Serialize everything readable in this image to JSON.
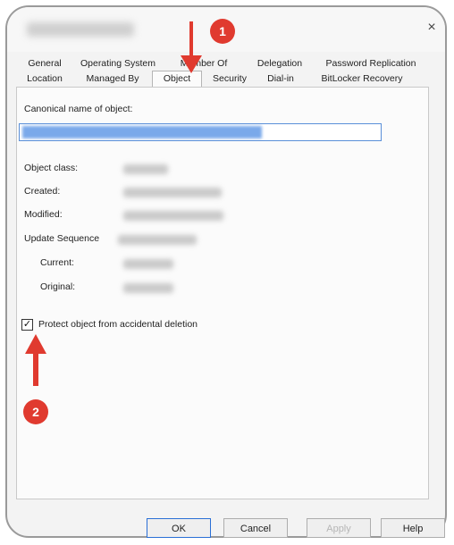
{
  "window": {
    "close_glyph": "×"
  },
  "tabs_row1": [
    "General",
    "Operating System",
    "Member Of",
    "Delegation",
    "Password Replication"
  ],
  "tabs_row2": [
    "Location",
    "Managed By",
    "Object",
    "Security",
    "Dial-in",
    "BitLocker Recovery"
  ],
  "object_tab": {
    "canonical_label": "Canonical name of object:",
    "object_class_label": "Object class:",
    "created_label": "Created:",
    "modified_label": "Modified:",
    "update_sequence_label": "Update Sequence",
    "current_label": "Current:",
    "original_label": "Original:",
    "protect_checked": true,
    "protect_label": "Protect object from accidental deletion"
  },
  "buttons": {
    "ok": "OK",
    "cancel": "Cancel",
    "apply": "Apply",
    "help": "Help"
  },
  "annotations": {
    "step1": "1",
    "step2": "2",
    "color": "#e03a2f"
  }
}
